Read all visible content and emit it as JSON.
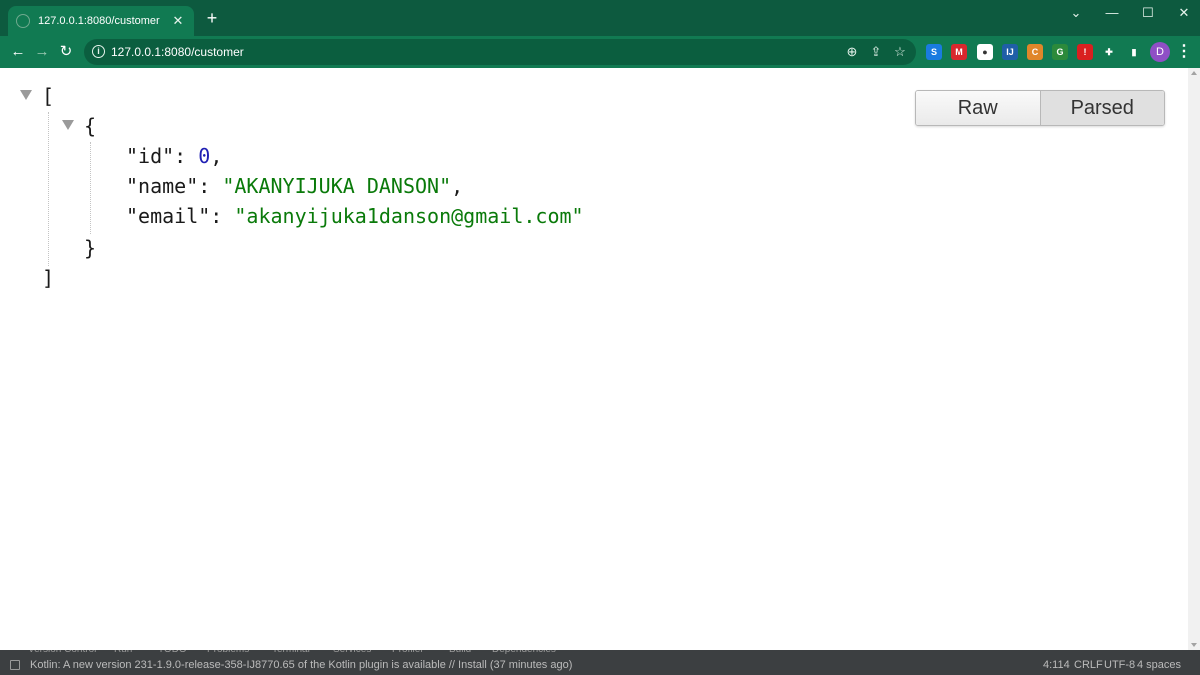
{
  "tab": {
    "title": "127.0.0.1:8080/customer",
    "close_glyph": "✕"
  },
  "window_controls": {
    "chevron": "⌄",
    "minimize": "—",
    "maximize": "☐",
    "close": "✕"
  },
  "toolbar": {
    "back_glyph": "←",
    "forward_glyph": "→",
    "reload_glyph": "↻",
    "url": "127.0.0.1:8080/customer",
    "zoom_glyph": "⊕",
    "share_glyph": "⇪",
    "bookmark_glyph": "☆",
    "profile_initial": "D",
    "menu_glyph": "⋮"
  },
  "extensions": [
    {
      "name": "shazam-extension-icon",
      "color": "#1a7be0",
      "glyph": "S"
    },
    {
      "name": "mega-extension-icon",
      "color": "#d9272e",
      "glyph": "M"
    },
    {
      "name": "circle-extension-icon",
      "color": "#ffffff",
      "glyph": "●"
    },
    {
      "name": "translate-extension-icon",
      "color": "#1f5fa8",
      "glyph": "IJ"
    },
    {
      "name": "capture-extension-icon",
      "color": "#e0862a",
      "glyph": "C"
    },
    {
      "name": "globe-extension-icon",
      "color": "#2c8a3b",
      "glyph": "G"
    },
    {
      "name": "shield-extension-icon",
      "color": "#d92020",
      "glyph": "!"
    },
    {
      "name": "puzzle-extension-icon",
      "color": "#117a52",
      "glyph": "✚"
    },
    {
      "name": "sidepanel-extension-icon",
      "color": "#117a52",
      "glyph": "▮"
    }
  ],
  "json_view": {
    "open_array": "[",
    "close_array": "]",
    "open_object": "{",
    "close_object": "}",
    "fields": [
      {
        "key": "\"id\"",
        "sep": ": ",
        "value": "0",
        "type": "number",
        "trail": ","
      },
      {
        "key": "\"name\"",
        "sep": ": ",
        "value": "\"AKANYIJUKA DANSON\"",
        "type": "string",
        "trail": ","
      },
      {
        "key": "\"email\"",
        "sep": ": ",
        "value": "\"akanyijuka1danson@gmail.com\"",
        "type": "string",
        "trail": ""
      }
    ],
    "toggle": {
      "raw_label": "Raw",
      "parsed_label": "Parsed",
      "active": "Parsed"
    }
  },
  "ide_status": {
    "message": "Kotlin: A new version 231-1.9.0-release-358-IJ8770.65 of the Kotlin plugin is available // Install (37 minutes ago)",
    "position": "4:114",
    "line_ending": "CRLF",
    "encoding": "UTF-8",
    "indent": "4 spaces",
    "tool_windows": [
      "Version Control",
      "Run",
      "TODO",
      "Problems",
      "Terminal",
      "Services",
      "Profiler",
      "Build",
      "Dependencies"
    ]
  }
}
